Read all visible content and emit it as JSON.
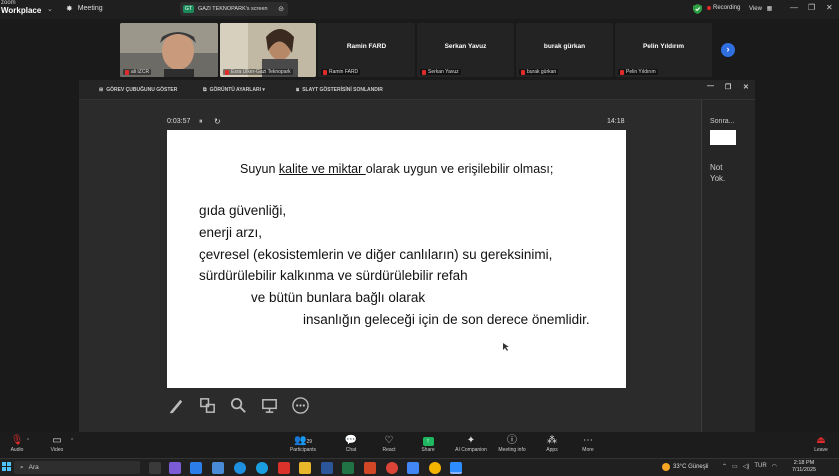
{
  "titlebar": {
    "logo_small": "zoom",
    "logo_main": "Workplace",
    "logo_caret": "⌄",
    "meeting_label": "Meeting",
    "screen_badge": "GT",
    "screen_tab_label": "GAZI TEKNOPARK's screen",
    "recording_label": "Recording",
    "view_label": "View",
    "accent": "#2f6fe0"
  },
  "participants": [
    {
      "label": "ali IZCR",
      "name": ""
    },
    {
      "label": "Esra Ulker-Gazi Teknopark",
      "name": ""
    },
    {
      "label": "Ramin FARD",
      "name": "Ramin FARD"
    },
    {
      "label": "Serkan Yavuz",
      "name": "Serkan Yavuz"
    },
    {
      "label": "burak gürkan",
      "name": "burak gürkan"
    },
    {
      "label": "Pelin Yıldırım",
      "name": "Pelin Yıldırım"
    }
  ],
  "share_toolbar": {
    "taskbar_btn": "GÖREV ÇUBUĞUNU GÖSTER",
    "display_btn": "GÖRÜNTÜ AYARLARI ▾",
    "end_btn": "SLAYT GÖSTERİSİNİ SONLANDIR",
    "window_controls": [
      "—",
      "❐",
      "✕"
    ]
  },
  "presenter": {
    "elapsed": "0:03:57",
    "pause_symbol": "⏸",
    "restart_symbol": "↻",
    "clock": "14:18",
    "next_title": "Sonra...",
    "next_none_1": "Not",
    "next_none_2": "Yok."
  },
  "slide": {
    "line1_pre": "Suyun ",
    "line1_ul": "kalite ve miktar ",
    "line1_post": "olarak uygun ve erişilebilir olması;",
    "items": [
      "gıda güvenliği,",
      "enerji arzı,",
      "çevresel (ekosistemlerin ve diğer canlıların) su gereksinimi,",
      "sürdürülebilir kalkınma ve sürdürülebilir refah",
      "ve bütün bunlara bağlı olarak",
      "insanlığın geleceği için de son derece önemlidir."
    ]
  },
  "bottom_toolbar": {
    "audio": "Audio",
    "video": "Video",
    "participants": "Participants",
    "participants_count": "29",
    "chat": "Chat",
    "react": "React",
    "share": "Share",
    "ai": "AI Companion",
    "info": "Meeting info",
    "apps": "Apps",
    "more": "More",
    "leave": "Leave"
  },
  "taskbar": {
    "search_placeholder": "Ara",
    "weather": "33°C  Güneşli",
    "lang": "TUR",
    "time": "2:18 PM",
    "date": "7/11/2025"
  }
}
